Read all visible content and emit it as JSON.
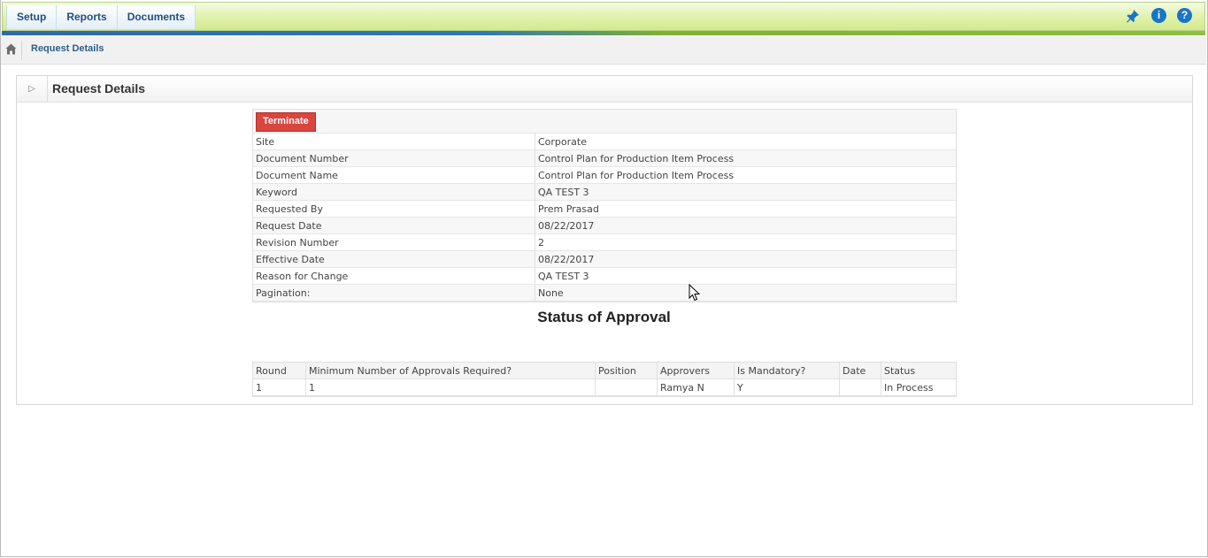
{
  "menu": {
    "items": [
      {
        "label": "Setup"
      },
      {
        "label": "Reports"
      },
      {
        "label": "Documents"
      }
    ]
  },
  "toolbar_icons": [
    "pin-icon",
    "info-icon",
    "help-icon"
  ],
  "toolbar_glyphs": {
    "info": "i",
    "help": "?"
  },
  "breadcrumb": {
    "current": "Request Details"
  },
  "panel": {
    "title": "Request Details",
    "collapse_glyph": "▷"
  },
  "details": {
    "terminate_label": "Terminate",
    "rows": [
      {
        "label": "Site",
        "value": "Corporate"
      },
      {
        "label": "Document Number",
        "value": "Control Plan for Production Item Process"
      },
      {
        "label": "Document Name",
        "value": "Control Plan for Production Item Process"
      },
      {
        "label": "Keyword",
        "value": "QA TEST 3"
      },
      {
        "label": "Requested By",
        "value": "Prem Prasad"
      },
      {
        "label": "Request Date",
        "value": "08/22/2017"
      },
      {
        "label": "Revision Number",
        "value": "2"
      },
      {
        "label": "Effective Date",
        "value": "08/22/2017"
      },
      {
        "label": "Reason for Change",
        "value": "QA TEST 3"
      },
      {
        "label": "Pagination:",
        "value": "None"
      }
    ]
  },
  "approval": {
    "title": "Status of Approval",
    "headers": [
      "Round",
      "Minimum Number of Approvals Required?",
      "Position",
      "Approvers",
      "Is Mandatory?",
      "Date",
      "Status"
    ],
    "rows": [
      [
        "1",
        "1",
        "",
        "Ramya N",
        "Y",
        "",
        "In Process"
      ]
    ]
  },
  "colors": {
    "accent": "#1a74c7",
    "danger": "#d9453f",
    "link": "#0f7fd1"
  }
}
